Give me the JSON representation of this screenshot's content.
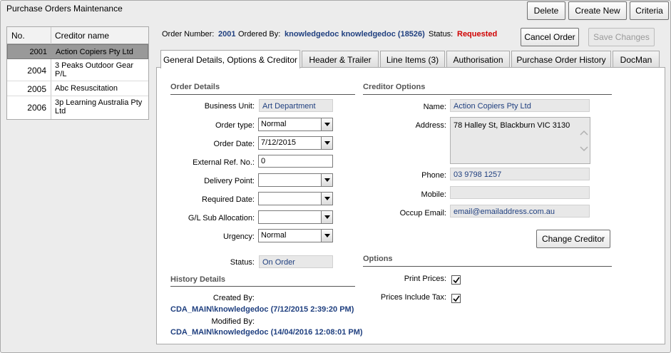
{
  "window_title": "Purchase Orders Maintenance",
  "toolbar": {
    "delete": "Delete",
    "create_new": "Create New",
    "criteria": "Criteria"
  },
  "creditor_list": {
    "headers": [
      "No.",
      "Creditor name"
    ],
    "rows": [
      {
        "no": "2001",
        "name": "Action Copiers Pty Ltd",
        "selected": true
      },
      {
        "no": "2004",
        "name": "3 Peaks Outdoor Gear P/L",
        "selected": false
      },
      {
        "no": "2005",
        "name": "Abc Resuscitation",
        "selected": false
      },
      {
        "no": "2006",
        "name": "3p Learning Australia Pty Ltd",
        "selected": false
      }
    ]
  },
  "order_info": {
    "order_number_label": "Order Number:",
    "order_number": "2001",
    "ordered_by_label": "Ordered By:",
    "ordered_by": "knowledgedoc knowledgedoc (18526)",
    "status_label": "Status:",
    "status": "Requested"
  },
  "actions": {
    "cancel_order": "Cancel Order",
    "save_changes": "Save Changes"
  },
  "tabs": [
    "General Details, Options & Creditor",
    "Header & Trailer",
    "Line Items (3)",
    "Authorisation",
    "Purchase Order History",
    "DocMan"
  ],
  "order_details": {
    "title": "Order Details",
    "business_unit_label": "Business Unit:",
    "business_unit": "Art Department",
    "order_type_label": "Order type:",
    "order_type": "Normal",
    "order_date_label": "Order Date:",
    "order_date": "7/12/2015",
    "external_ref_label": "External Ref. No.:",
    "external_ref": "0",
    "delivery_point_label": "Delivery Point:",
    "delivery_point": "",
    "required_date_label": "Required Date:",
    "required_date": "",
    "gl_sub_label": "G/L Sub Allocation:",
    "gl_sub": "",
    "urgency_label": "Urgency:",
    "urgency": "Normal",
    "status_label": "Status:",
    "status": "On Order"
  },
  "history": {
    "title": "History Details",
    "created_by_label": "Created By:",
    "created_by": "CDA_MAIN\\knowledgedoc (7/12/2015 2:39:20 PM)",
    "modified_by_label": "Modified By:",
    "modified_by": "CDA_MAIN\\knowledgedoc (14/04/2016 12:08:01 PM)"
  },
  "creditor_options": {
    "title": "Creditor Options",
    "name_label": "Name:",
    "name": "Action Copiers Pty Ltd",
    "address_label": "Address:",
    "address": "78 Halley St, Blackburn VIC 3130",
    "phone_label": "Phone:",
    "phone": "03 9798 1257",
    "mobile_label": "Mobile:",
    "mobile": "",
    "email_label": "Occup Email:",
    "email": "email@emailaddress.com.au",
    "change_creditor": "Change Creditor"
  },
  "options": {
    "title": "Options",
    "print_prices_label": "Print Prices:",
    "print_prices": true,
    "prices_include_tax_label": "Prices Include Tax:",
    "prices_include_tax": true
  }
}
